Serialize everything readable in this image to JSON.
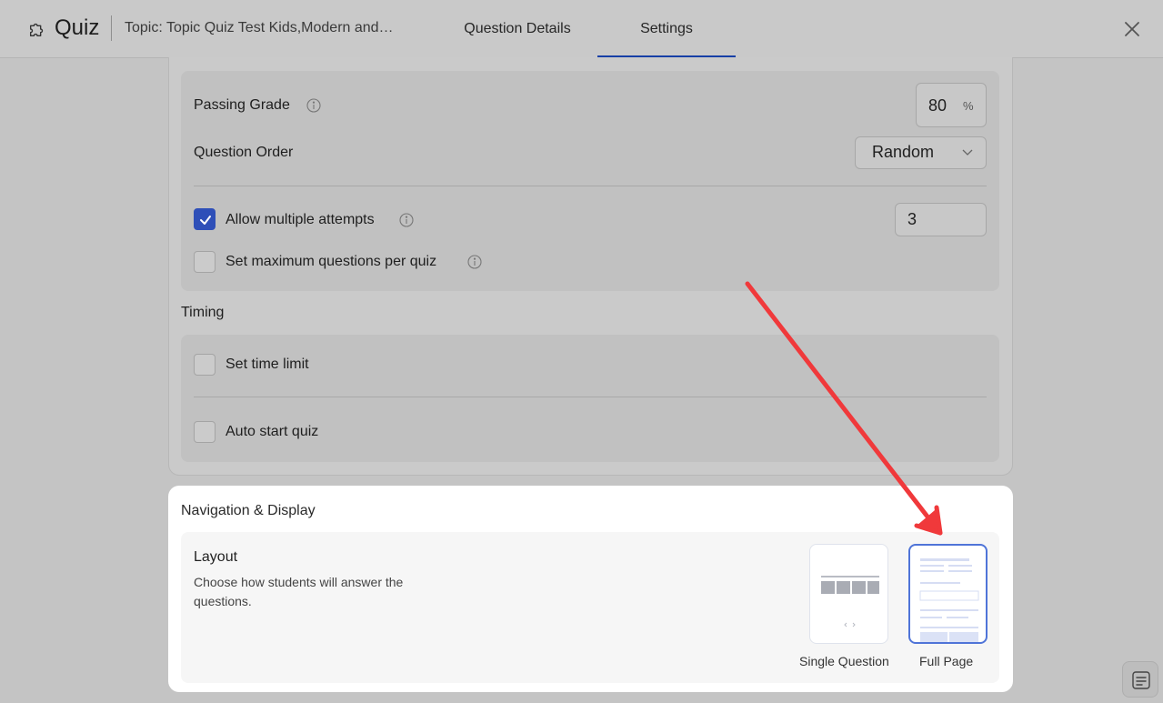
{
  "header": {
    "app_icon": "puzzle-icon",
    "app_title": "Quiz",
    "topic": "Topic: Topic Quiz Test Kids,Modern and…",
    "tabs": [
      {
        "label": "Question Details",
        "active": false
      },
      {
        "label": "Settings",
        "active": true
      }
    ],
    "close_icon": "close-icon"
  },
  "general": {
    "passing_grade_label": "Passing Grade",
    "passing_grade_value": "80",
    "passing_grade_unit": "%",
    "question_order_label": "Question Order",
    "question_order_value": "Random",
    "allow_attempts_label": "Allow multiple attempts",
    "allow_attempts_checked": true,
    "attempts_value": "3",
    "max_questions_label": "Set maximum questions per quiz",
    "max_questions_checked": false
  },
  "timing": {
    "title": "Timing",
    "time_limit_label": "Set time limit",
    "auto_start_label": "Auto start quiz"
  },
  "navigation": {
    "title": "Navigation & Display",
    "layout_title": "Layout",
    "layout_description": "Choose how students will answer the questions.",
    "options": [
      {
        "label": "Single Question",
        "selected": false
      },
      {
        "label": "Full Page",
        "selected": true
      }
    ]
  },
  "colors": {
    "accent": "#2e4fb8",
    "annotation_arrow": "#f0393b"
  }
}
